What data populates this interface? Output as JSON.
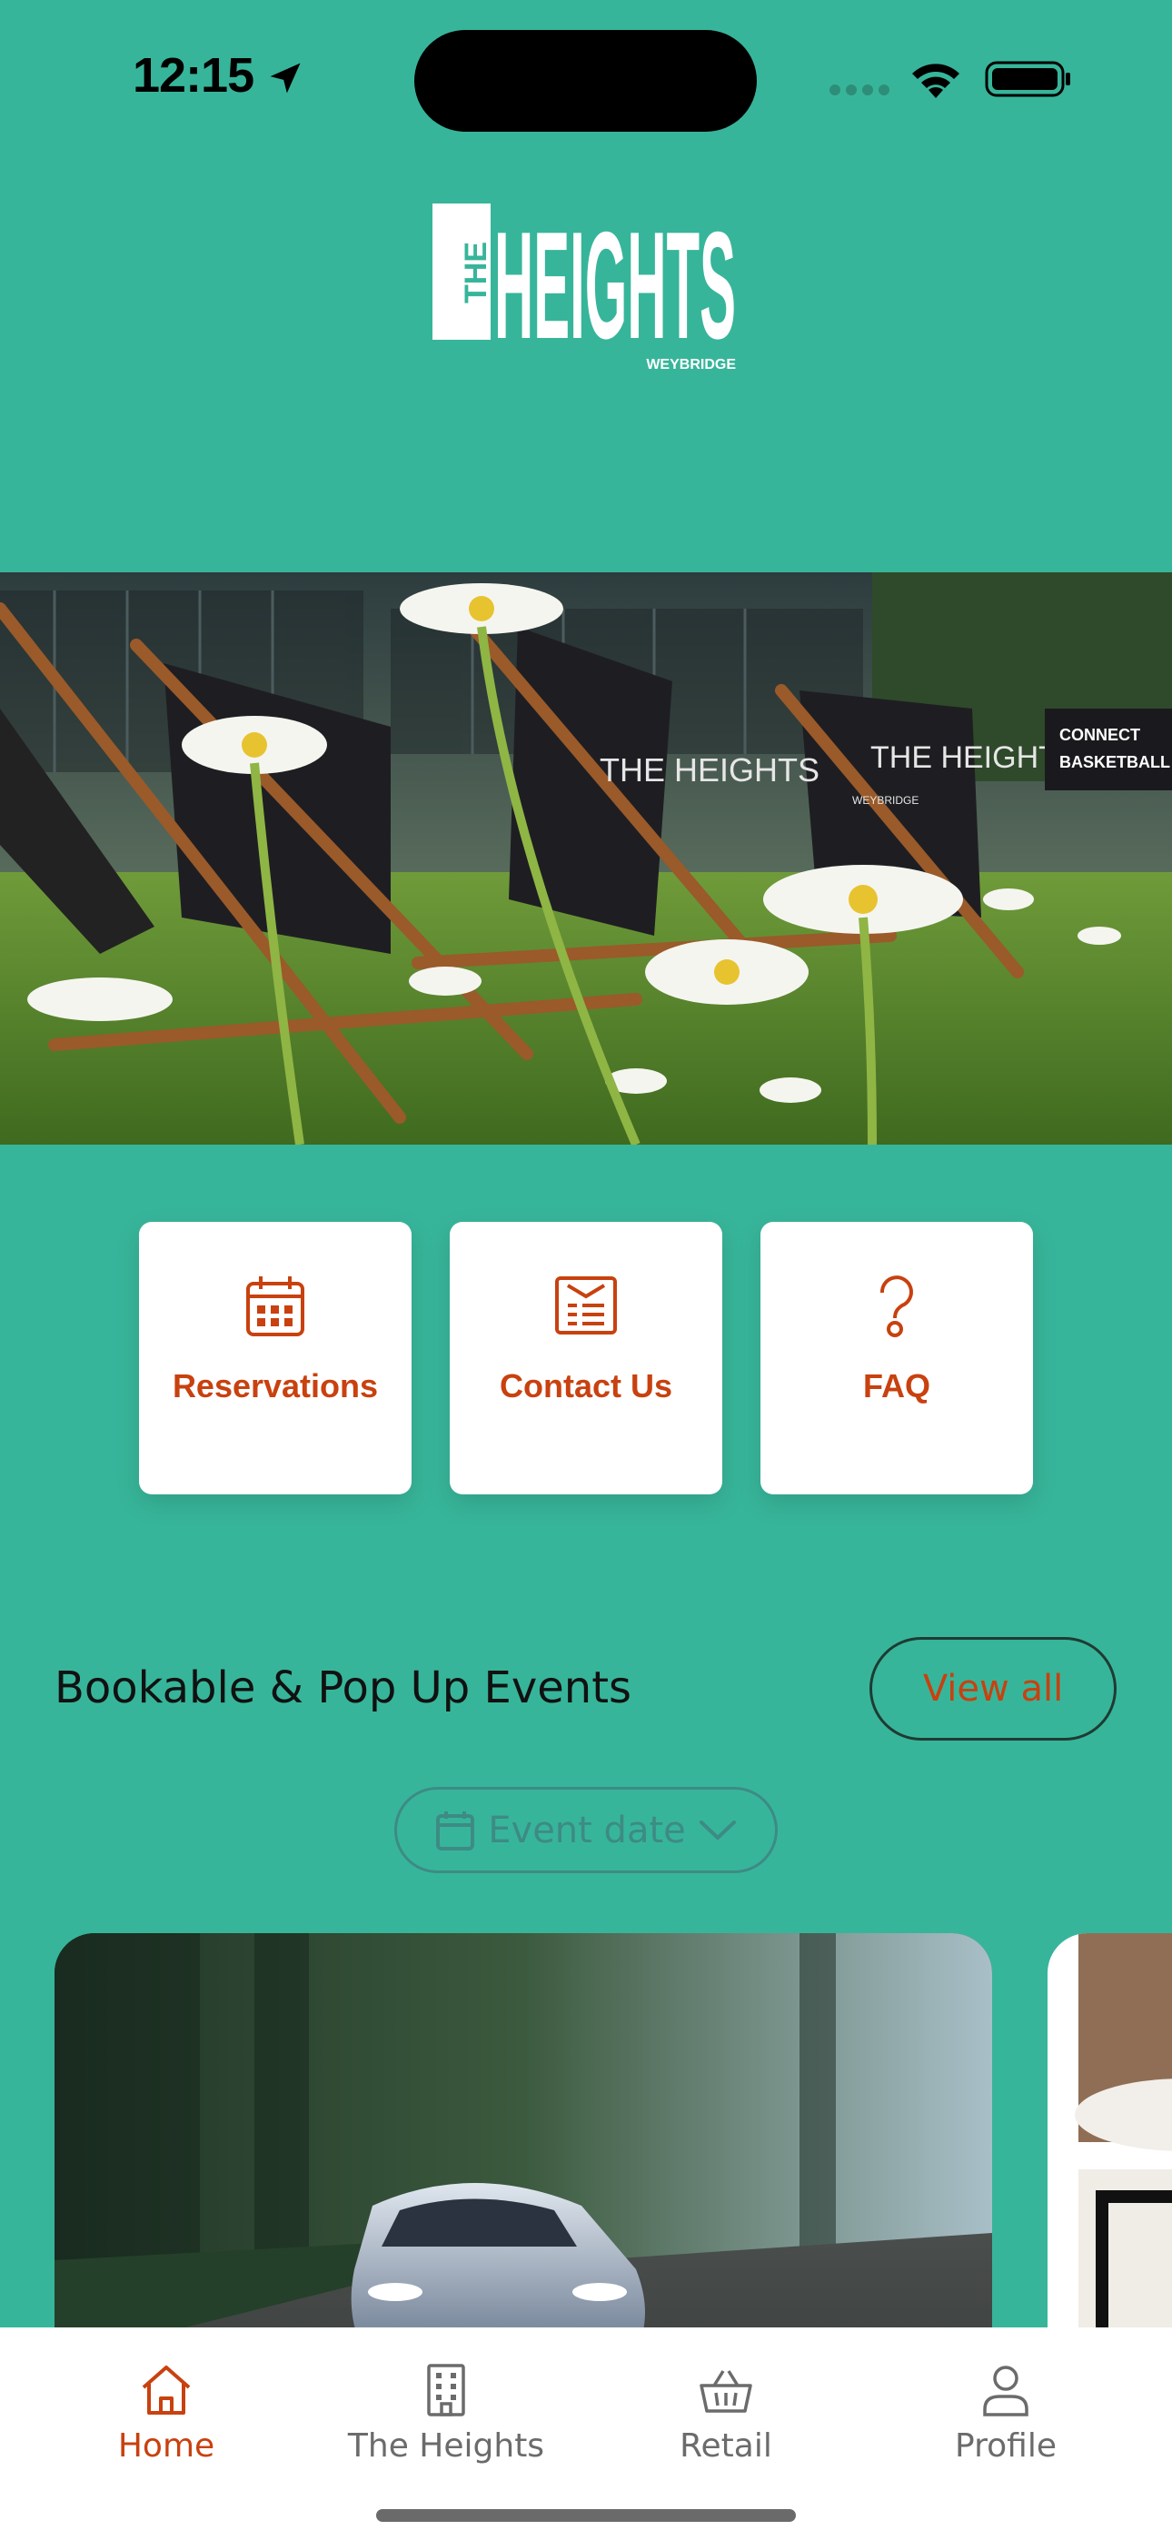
{
  "status_bar": {
    "time": "12:15"
  },
  "logo": {
    "line1": "THE",
    "line2": "HEIGHTS",
    "sub": "WEYBRIDGE"
  },
  "hero": {
    "chair_text": "THE HEIGHTS",
    "chair_sub": "WEYBRIDGE",
    "sign_line1": "CONNECT",
    "sign_line2": "BASKETBALL"
  },
  "quick_actions": [
    {
      "label": "Reservations",
      "icon": "calendar-icon"
    },
    {
      "label": "Contact Us",
      "icon": "newsletter-icon"
    },
    {
      "label": "FAQ",
      "icon": "question-icon"
    }
  ],
  "events": {
    "title": "Bookable & Pop Up Events",
    "view_all": "View all",
    "date_filter": "Event date"
  },
  "tabs": [
    {
      "label": "Home",
      "icon": "home-icon",
      "active": true
    },
    {
      "label": "The Heights",
      "icon": "building-icon",
      "active": false
    },
    {
      "label": "Retail",
      "icon": "basket-icon",
      "active": false
    },
    {
      "label": "Profile",
      "icon": "person-icon",
      "active": false
    }
  ],
  "colors": {
    "background": "#37b59a",
    "accent": "#c8410f",
    "tab_inactive": "#6b6b6b"
  }
}
